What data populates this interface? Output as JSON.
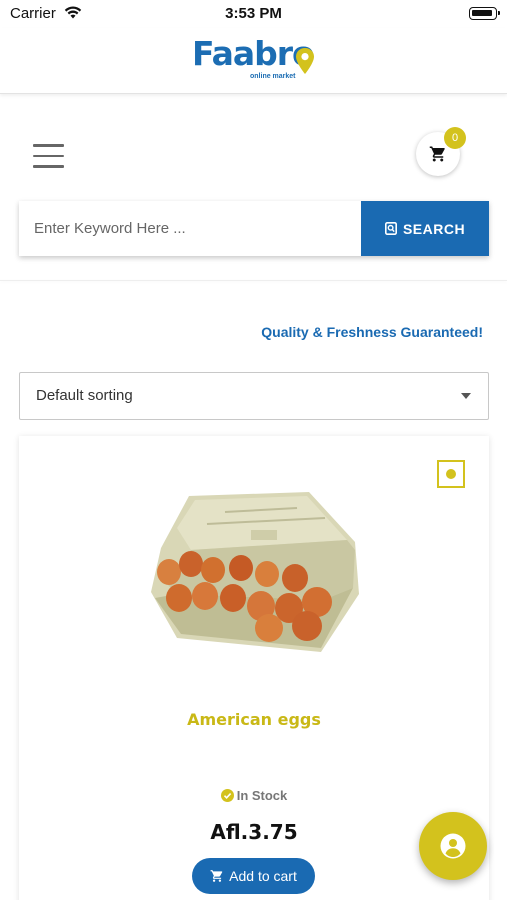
{
  "status_bar": {
    "carrier": "Carrier",
    "time": "3:53 PM"
  },
  "header": {
    "logo_text": "Faabro",
    "logo_subtitle": "online market"
  },
  "toolbar": {
    "cart_count": "0"
  },
  "search": {
    "placeholder": "Enter Keyword Here ...",
    "button_label": "SEARCH"
  },
  "tagline": "Quality & Freshness Guaranteed!",
  "sorting": {
    "selected": "Default sorting"
  },
  "product": {
    "name": "American eggs",
    "stock_status": "In Stock",
    "price": "Afl.3.75",
    "add_to_cart_label": "Add to cart"
  },
  "colors": {
    "brand_blue": "#1a6ab2",
    "brand_yellow": "#d3c21d"
  },
  "icons": [
    "wifi-icon",
    "battery-icon",
    "menu-icon",
    "cart-icon",
    "search-icon",
    "quick-view-icon",
    "check-circle-icon",
    "add-cart-icon",
    "account-icon"
  ]
}
